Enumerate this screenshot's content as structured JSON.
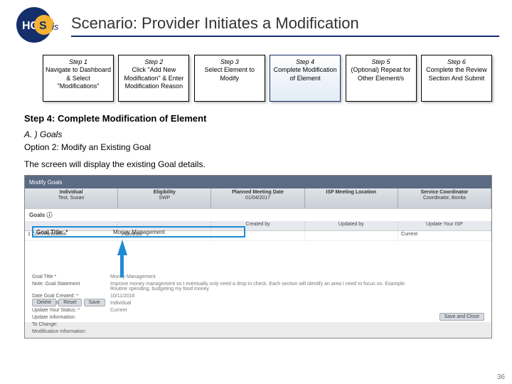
{
  "title": "Scenario: Provider Initiates a Modification",
  "steps": [
    {
      "head": "Step 1",
      "body": "Navigate to Dashboard & Select \"Modifications\"",
      "active": false
    },
    {
      "head": "Step 2",
      "body": "Click \"Add New Modification\" & Enter Modification Reason",
      "active": false
    },
    {
      "head": "Step 3",
      "body": "Select Element to Modify",
      "active": false
    },
    {
      "head": "Step 4",
      "body": "Complete Modification of Element",
      "active": true
    },
    {
      "head": "Step 5",
      "body": "(Optional) Repeat for Other Element/s",
      "active": false
    },
    {
      "head": "Step 6",
      "body": "Complete the Review Section And Submit",
      "active": false
    }
  ],
  "section": "Step 4: Complete Modification of Element",
  "sub1": "A. ) Goals",
  "sub2": "Option 2: Modify an Existing Goal",
  "desc": "The screen will display the existing Goal details.",
  "ss": {
    "bar": "Modify Goals",
    "tabs": [
      {
        "t1": "Individual",
        "t2": "Test, Susan"
      },
      {
        "t1": "Eligibility",
        "t2": "SWP"
      },
      {
        "t1": "Planned Meeting Date",
        "t2": "01/04/2017"
      },
      {
        "t1": "ISP Meeting Location",
        "t2": ""
      },
      {
        "t1": "Service Coordinator",
        "t2": "Coordinator, Bonita"
      }
    ],
    "goalsLabel": "Goals ⓘ",
    "gridHeaders": [
      "",
      "",
      "Created by",
      "Updated by",
      "Update Your ISP"
    ],
    "gridRow1": [
      "1  Communication",
      "Individual",
      "",
      "",
      "Current"
    ],
    "goal": {
      "label": "Goal Title: *",
      "value": "Money Management"
    },
    "form": [
      {
        "l": "Goal Title *",
        "v": "Money Management"
      },
      {
        "l": "Note: Goal Statement",
        "v": "Improve money management so I eventually only need a drop in check. Each section will identify an area I need to focus on. Example: Routine spending, budgeting my food money"
      },
      {
        "l": "Date Goal Created: *",
        "v": "10/11/2016"
      },
      {
        "l": "Goal Identified By: *",
        "v": "Individual"
      },
      {
        "l": "Update Your Status: *",
        "v": "Current"
      },
      {
        "l": "Update Information:",
        "v": ""
      },
      {
        "l": "To Change:",
        "v": ""
      },
      {
        "l": "Modification Information:",
        "v": ""
      }
    ],
    "btns": [
      "Delete",
      "Reset",
      "Save"
    ],
    "bottom": "Save and Close"
  },
  "page": "36"
}
